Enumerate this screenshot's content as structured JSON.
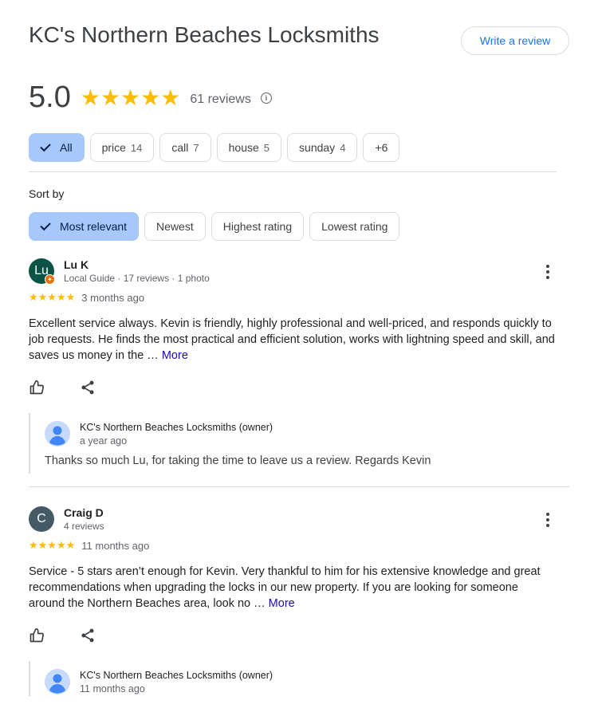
{
  "business": {
    "title": "KC's Northern Beaches Locksmiths",
    "write_review": "Write a review"
  },
  "summary": {
    "rating": "5.0",
    "stars": "★★★★★",
    "review_count": "61 reviews",
    "rating_fraction": 1.0
  },
  "topics": [
    {
      "label": "All",
      "count": ""
    },
    {
      "label": "price",
      "count": "14"
    },
    {
      "label": "call",
      "count": "7"
    },
    {
      "label": "house",
      "count": "5"
    },
    {
      "label": "sunday",
      "count": "4"
    },
    {
      "label": "+6",
      "count": ""
    }
  ],
  "sort": {
    "label": "Sort by",
    "options": [
      "Most relevant",
      "Newest",
      "Highest rating",
      "Lowest rating"
    ],
    "selected": "Most relevant"
  },
  "reviews": [
    {
      "avatar_text": "Lu",
      "avatar_color": "#0b5345",
      "name": "Lu K",
      "meta": "Local Guide · 17 reviews · 1 photo",
      "stars": "★★★★★",
      "rating": 5,
      "time": "3 months ago",
      "text": "Excellent service always. Kevin is friendly, highly professional and well-priced, and responds quickly to job requests. He finds the most practical and efficient solution, works with lightning speed and skill, and saves us money in the …",
      "more": "More",
      "owner_reply": {
        "name": "KC's Northern Beaches Locksmiths (owner)",
        "time": "a year ago",
        "text": "Thanks so much Lu, for taking the time to leave us a review. Regards Kevin"
      }
    },
    {
      "avatar_text": "C",
      "avatar_color": "#455a64",
      "name": "Craig D",
      "meta": "4 reviews",
      "stars": "★★★★★",
      "rating": 5,
      "time": "11 months ago",
      "text": "Service - 5 stars aren’t enough for Kevin. Very thankful to him for his extensive knowledge and great recommendations when upgrading the locks in our new property. If you are looking for someone around the Northern Beaches area, look no …",
      "more": "More",
      "owner_reply": {
        "name": "KC's Northern Beaches Locksmiths (owner)",
        "time": "11 months ago",
        "text": ""
      }
    }
  ],
  "colors": {
    "accent": "#1a73e8",
    "star": "#fbbc04",
    "chip_selected": "#a8c7fa",
    "link": "#1a0dab"
  },
  "icons": {
    "info": "info-icon",
    "like": "thumbs-up-icon",
    "share": "share-icon",
    "menu": "more-vert-icon",
    "check": "check-icon"
  }
}
